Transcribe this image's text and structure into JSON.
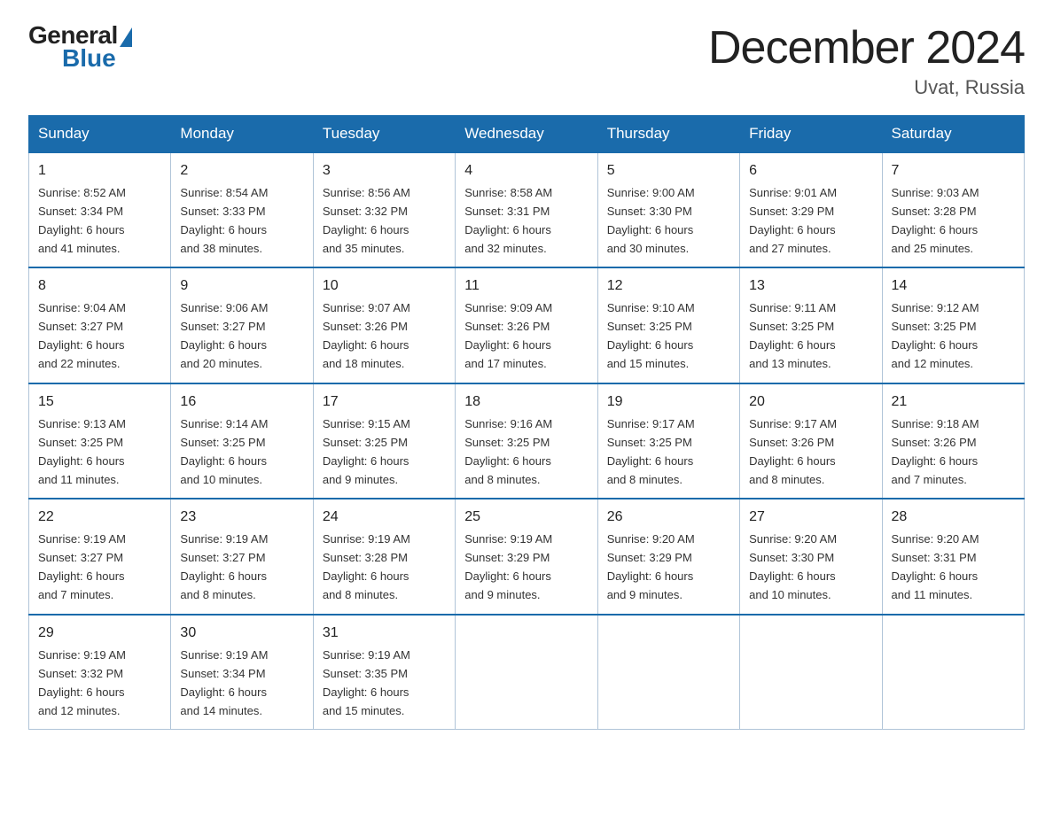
{
  "header": {
    "logo_general": "General",
    "logo_blue": "Blue",
    "month_title": "December 2024",
    "location": "Uvat, Russia"
  },
  "days_of_week": [
    "Sunday",
    "Monday",
    "Tuesday",
    "Wednesday",
    "Thursday",
    "Friday",
    "Saturday"
  ],
  "weeks": [
    [
      {
        "day": "1",
        "sunrise": "8:52 AM",
        "sunset": "3:34 PM",
        "daylight": "6 hours and 41 minutes."
      },
      {
        "day": "2",
        "sunrise": "8:54 AM",
        "sunset": "3:33 PM",
        "daylight": "6 hours and 38 minutes."
      },
      {
        "day": "3",
        "sunrise": "8:56 AM",
        "sunset": "3:32 PM",
        "daylight": "6 hours and 35 minutes."
      },
      {
        "day": "4",
        "sunrise": "8:58 AM",
        "sunset": "3:31 PM",
        "daylight": "6 hours and 32 minutes."
      },
      {
        "day": "5",
        "sunrise": "9:00 AM",
        "sunset": "3:30 PM",
        "daylight": "6 hours and 30 minutes."
      },
      {
        "day": "6",
        "sunrise": "9:01 AM",
        "sunset": "3:29 PM",
        "daylight": "6 hours and 27 minutes."
      },
      {
        "day": "7",
        "sunrise": "9:03 AM",
        "sunset": "3:28 PM",
        "daylight": "6 hours and 25 minutes."
      }
    ],
    [
      {
        "day": "8",
        "sunrise": "9:04 AM",
        "sunset": "3:27 PM",
        "daylight": "6 hours and 22 minutes."
      },
      {
        "day": "9",
        "sunrise": "9:06 AM",
        "sunset": "3:27 PM",
        "daylight": "6 hours and 20 minutes."
      },
      {
        "day": "10",
        "sunrise": "9:07 AM",
        "sunset": "3:26 PM",
        "daylight": "6 hours and 18 minutes."
      },
      {
        "day": "11",
        "sunrise": "9:09 AM",
        "sunset": "3:26 PM",
        "daylight": "6 hours and 17 minutes."
      },
      {
        "day": "12",
        "sunrise": "9:10 AM",
        "sunset": "3:25 PM",
        "daylight": "6 hours and 15 minutes."
      },
      {
        "day": "13",
        "sunrise": "9:11 AM",
        "sunset": "3:25 PM",
        "daylight": "6 hours and 13 minutes."
      },
      {
        "day": "14",
        "sunrise": "9:12 AM",
        "sunset": "3:25 PM",
        "daylight": "6 hours and 12 minutes."
      }
    ],
    [
      {
        "day": "15",
        "sunrise": "9:13 AM",
        "sunset": "3:25 PM",
        "daylight": "6 hours and 11 minutes."
      },
      {
        "day": "16",
        "sunrise": "9:14 AM",
        "sunset": "3:25 PM",
        "daylight": "6 hours and 10 minutes."
      },
      {
        "day": "17",
        "sunrise": "9:15 AM",
        "sunset": "3:25 PM",
        "daylight": "6 hours and 9 minutes."
      },
      {
        "day": "18",
        "sunrise": "9:16 AM",
        "sunset": "3:25 PM",
        "daylight": "6 hours and 8 minutes."
      },
      {
        "day": "19",
        "sunrise": "9:17 AM",
        "sunset": "3:25 PM",
        "daylight": "6 hours and 8 minutes."
      },
      {
        "day": "20",
        "sunrise": "9:17 AM",
        "sunset": "3:26 PM",
        "daylight": "6 hours and 8 minutes."
      },
      {
        "day": "21",
        "sunrise": "9:18 AM",
        "sunset": "3:26 PM",
        "daylight": "6 hours and 7 minutes."
      }
    ],
    [
      {
        "day": "22",
        "sunrise": "9:19 AM",
        "sunset": "3:27 PM",
        "daylight": "6 hours and 7 minutes."
      },
      {
        "day": "23",
        "sunrise": "9:19 AM",
        "sunset": "3:27 PM",
        "daylight": "6 hours and 8 minutes."
      },
      {
        "day": "24",
        "sunrise": "9:19 AM",
        "sunset": "3:28 PM",
        "daylight": "6 hours and 8 minutes."
      },
      {
        "day": "25",
        "sunrise": "9:19 AM",
        "sunset": "3:29 PM",
        "daylight": "6 hours and 9 minutes."
      },
      {
        "day": "26",
        "sunrise": "9:20 AM",
        "sunset": "3:29 PM",
        "daylight": "6 hours and 9 minutes."
      },
      {
        "day": "27",
        "sunrise": "9:20 AM",
        "sunset": "3:30 PM",
        "daylight": "6 hours and 10 minutes."
      },
      {
        "day": "28",
        "sunrise": "9:20 AM",
        "sunset": "3:31 PM",
        "daylight": "6 hours and 11 minutes."
      }
    ],
    [
      {
        "day": "29",
        "sunrise": "9:19 AM",
        "sunset": "3:32 PM",
        "daylight": "6 hours and 12 minutes."
      },
      {
        "day": "30",
        "sunrise": "9:19 AM",
        "sunset": "3:34 PM",
        "daylight": "6 hours and 14 minutes."
      },
      {
        "day": "31",
        "sunrise": "9:19 AM",
        "sunset": "3:35 PM",
        "daylight": "6 hours and 15 minutes."
      },
      null,
      null,
      null,
      null
    ]
  ],
  "labels": {
    "sunrise": "Sunrise:",
    "sunset": "Sunset:",
    "daylight": "Daylight:"
  }
}
